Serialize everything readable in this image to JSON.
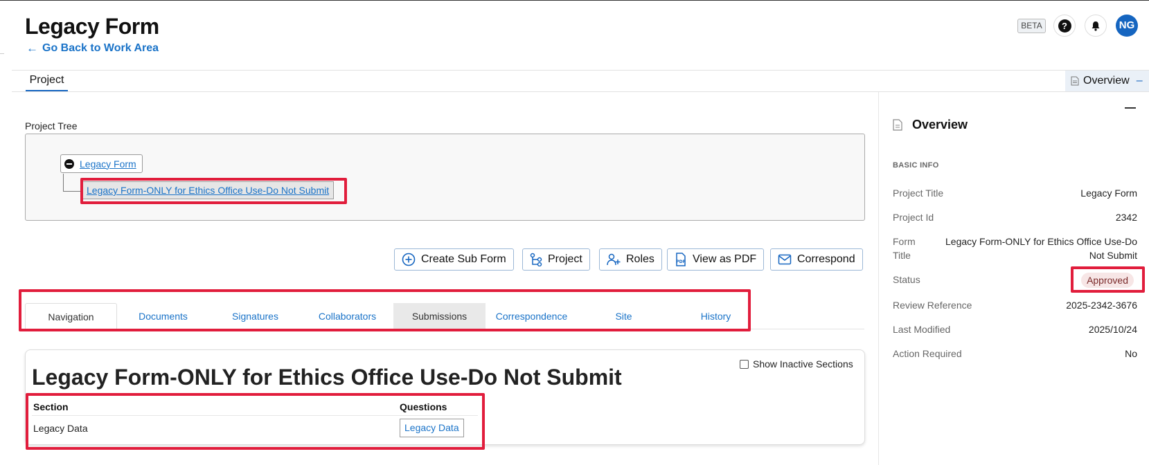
{
  "header": {
    "title": "Legacy Form",
    "back_link": "Go Back to Work Area",
    "beta_label": "BETA",
    "help_icon": "?",
    "avatar_initials": "NG"
  },
  "tabbar": {
    "project_tab": "Project",
    "overview_toggle": "Overview",
    "overview_toggle_sign": "–"
  },
  "project_tree": {
    "label": "Project Tree",
    "root": "Legacy Form",
    "child": "Legacy Form-ONLY for Ethics Office Use-Do Not Submit"
  },
  "actions": {
    "create_sub_form": "Create Sub Form",
    "project": "Project",
    "roles": "Roles",
    "view_as_pdf": "View as PDF",
    "pdf_icon_text": "PDF",
    "correspond": "Correspond"
  },
  "tabs": [
    "Navigation",
    "Documents",
    "Signatures",
    "Collaborators",
    "Submissions",
    "Correspondence",
    "Site",
    "History"
  ],
  "form": {
    "title": "Legacy Form-ONLY for Ethics Office Use-Do Not Submit",
    "show_inactive": "Show Inactive Sections",
    "columns": {
      "section": "Section",
      "questions": "Questions"
    },
    "rows": [
      {
        "section": "Legacy Data",
        "questions": "Legacy Data"
      }
    ]
  },
  "overview": {
    "title": "Overview",
    "section": "BASIC INFO",
    "fields": {
      "project_title": {
        "label": "Project Title",
        "value": "Legacy Form"
      },
      "project_id": {
        "label": "Project Id",
        "value": "2342"
      },
      "form_title": {
        "label": "Form Title",
        "value": "Legacy Form-ONLY for Ethics Office Use-Do Not Submit"
      },
      "status": {
        "label": "Status",
        "value": "Approved"
      },
      "review_reference": {
        "label": "Review Reference",
        "value": "2025-2342-3676"
      },
      "last_modified": {
        "label": "Last Modified",
        "value": "2025/10/24"
      },
      "action_required": {
        "label": "Action Required",
        "value": "No"
      }
    }
  },
  "colors": {
    "accent": "#1565c0",
    "link": "#1a73c8",
    "highlight": "#e11d3c",
    "status_bg": "#f7e6e6"
  }
}
